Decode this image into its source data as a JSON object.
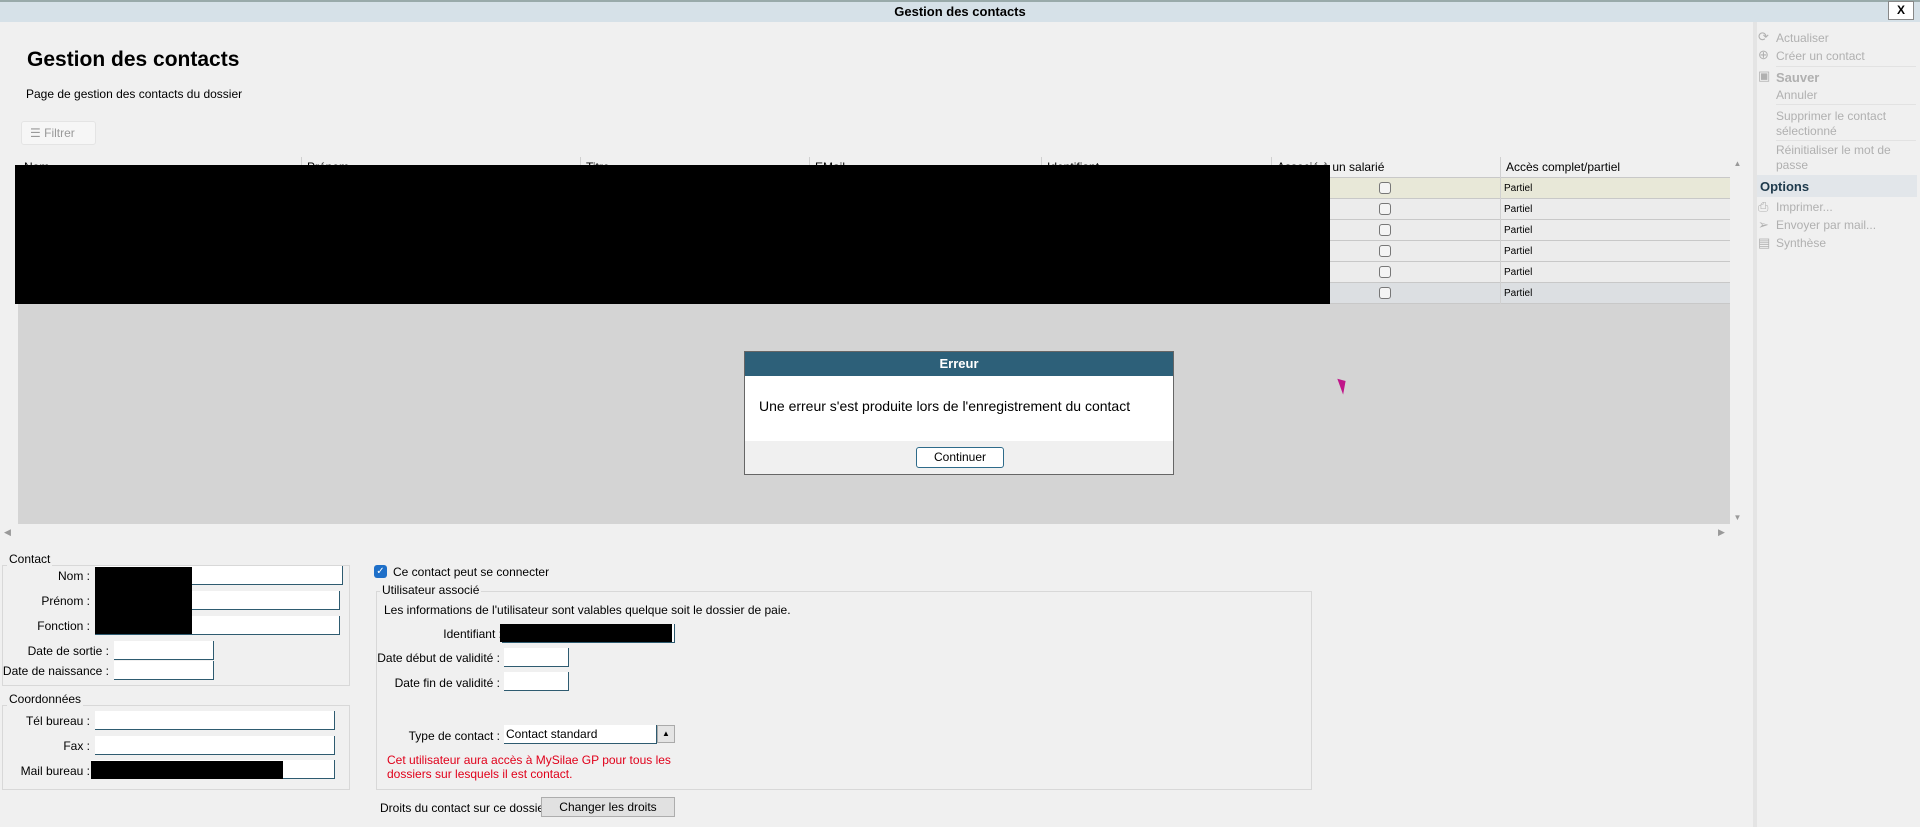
{
  "window": {
    "title": "Gestion des contacts",
    "close_label": "X"
  },
  "page": {
    "title": "Gestion des contacts",
    "subtitle": "Page de gestion des contacts du dossier",
    "filter_label": "Filtrer"
  },
  "table": {
    "columns": [
      "Nom",
      "Prénom",
      "Titre",
      "EMail",
      "Identifiant",
      "Associé à un salarié",
      "Accès complet/partiel"
    ],
    "rows": [
      {
        "associe": false,
        "acces": "Partiel"
      },
      {
        "associe": false,
        "acces": "Partiel"
      },
      {
        "associe": false,
        "acces": "Partiel"
      },
      {
        "associe": false,
        "acces": "Partiel"
      },
      {
        "associe": false,
        "acces": "Partiel"
      },
      {
        "associe": false,
        "acces": "Partiel"
      }
    ]
  },
  "dialog": {
    "title": "Erreur",
    "message": "Une erreur s'est produite lors de l'enregistrement du contact",
    "button": "Continuer",
    "header_color": "#2d6079"
  },
  "sidebar": {
    "items": [
      {
        "label": "Actualiser",
        "icon": "refresh-icon"
      },
      {
        "label": "Créer un contact",
        "icon": "plus-circle-icon"
      },
      {
        "label": "Sauver",
        "icon": "save-icon"
      },
      {
        "label": "Annuler"
      },
      {
        "label": "Supprimer le contact",
        "label2": "sélectionné"
      },
      {
        "label": "Réinitialiser le mot de",
        "label2": "passe"
      }
    ],
    "options_title": "Options",
    "options": [
      {
        "label": "Imprimer...",
        "icon": "printer-icon"
      },
      {
        "label": "Envoyer par mail...",
        "icon": "send-icon"
      },
      {
        "label": "Synthèse",
        "icon": "summary-icon"
      }
    ]
  },
  "contact": {
    "group": "Contact",
    "nom": "Nom :",
    "prenom": "Prénom :",
    "fonction": "Fonction :",
    "date_sortie": "Date de sortie :",
    "date_naissance": "Date de naissance :"
  },
  "coordonnees": {
    "group": "Coordonnées",
    "tel": "Tél bureau :",
    "fax": "Fax :",
    "mail": "Mail bureau :"
  },
  "user": {
    "can_connect_label": "Ce contact peut se connecter",
    "can_connect": true,
    "group": "Utilisateur associé",
    "info": "Les informations de l'utilisateur sont valables quelque soit le dossier de paie.",
    "identifiant": "Identifiant :",
    "date_debut": "Date début de validité :",
    "date_fin": "Date fin de validité :",
    "type_label": "Type de contact :",
    "type_value": "Contact standard",
    "warning": "Cet utilisateur aura accès à MySilae GP pour tous les",
    "warning2": "dossiers sur lesquels il est contact.",
    "warning_color": "#e0001a"
  },
  "rights": {
    "label": "Droits du contact sur ce dossier :",
    "button": "Changer les droits"
  }
}
